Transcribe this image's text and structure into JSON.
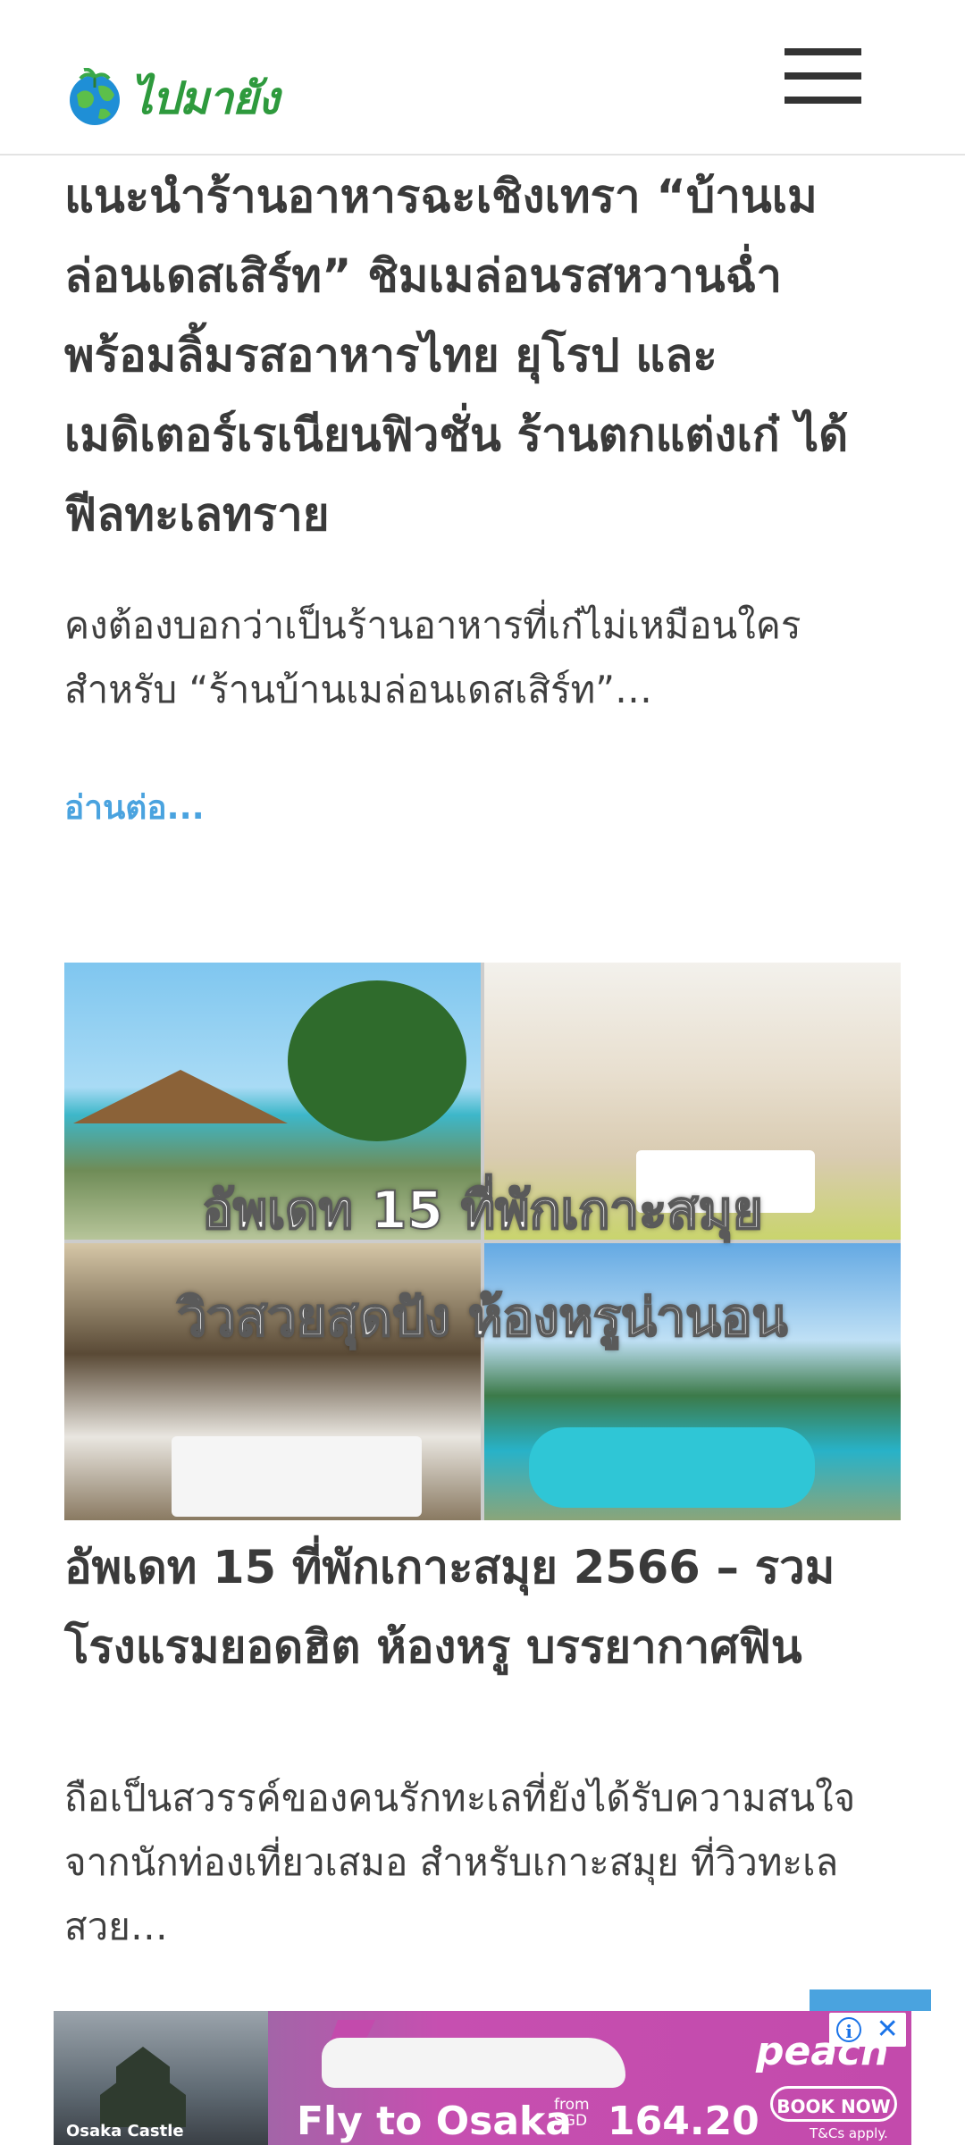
{
  "header": {
    "logo_text": "ไปมายัง",
    "menu_label": "menu"
  },
  "article1": {
    "title": "แนะนำร้านอาหารฉะเชิงเทรา “บ้านเมล่อนเดสเสิร์ท” ชิมเมล่อนรสหวานฉ่ำ พร้อมลิ้มรสอาหารไทย ยุโรป และเมดิเตอร์เรเนียนฟิวชั่น ร้านตกแต่งเก๋ ได้ฟีลทะเลทราย",
    "excerpt": "คงต้องบอกว่าเป็นร้านอาหารที่เก๋ไม่เหมือนใคร สำหรับ “ร้านบ้านเมล่อนเดสเสิร์ท”…",
    "read_more": "อ่านต่อ..."
  },
  "article2": {
    "image_text_line1": "อัพเดท 15 ที่พักเกาะสมุย",
    "image_text_line2": "วิวสวยสุดปัง ห้องหรูน่านอน",
    "title": "อัพเดท 15 ที่พักเกาะสมุย 2566 – รวมโรงแรมยอดฮิต ห้องหรู บรรยากาศฟิน",
    "excerpt": "ถือเป็นสวรรค์ของคนรักทะเลที่ยังได้รับความสนใจจากนักท่องเที่ยวเสมอ สำหรับเกาะสมุย ที่วิวทะเลสวย…"
  },
  "ad": {
    "brand": "peach",
    "headline": "Fly to Osaka",
    "from_label_1": "from",
    "from_label_2": "SGD",
    "price": "164.20",
    "cta": "BOOK NOW",
    "terms": "T&Cs apply.",
    "caption": "Osaka Castle",
    "info_icon": "i",
    "close_icon": "✕"
  },
  "colors": {
    "link": "#4aa3df",
    "logo_green": "#2e9a3d",
    "ad_purple": "#c34aac"
  }
}
